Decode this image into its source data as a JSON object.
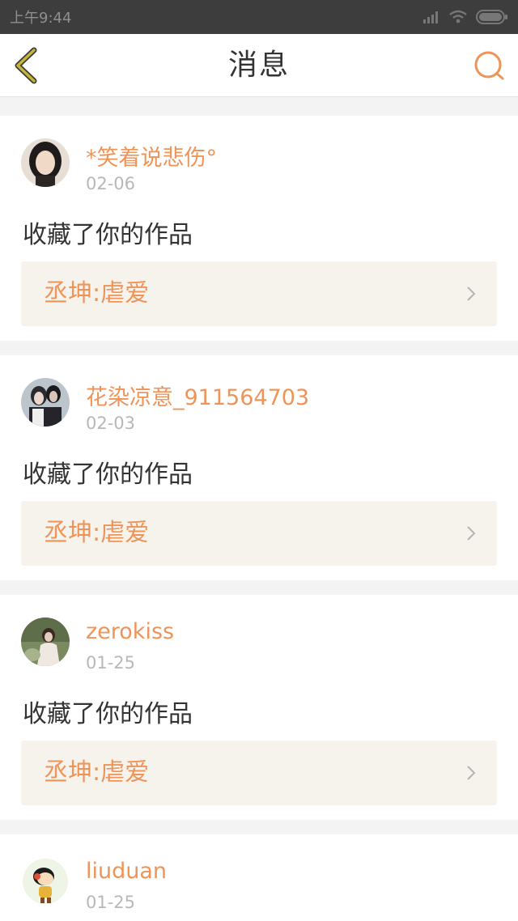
{
  "status_bar": {
    "time": "上午9:44",
    "icons": [
      "signal-icon",
      "wifi-icon",
      "battery-icon"
    ]
  },
  "header": {
    "title": "消息",
    "back_icon": "chevron-left-icon",
    "search_icon": "search-icon"
  },
  "colors": {
    "accent": "#ee9459",
    "back_arrow": "#b6ad2f",
    "card_link_bg": "#f5f3ec",
    "status_bar_bg": "#3d3d3d"
  },
  "messages": [
    {
      "username": "*笑着说悲伤°",
      "date": "02-06",
      "action": "收藏了你的作品",
      "work_title": "丞坤:虐爱"
    },
    {
      "username": "花染凉意_911564703",
      "date": "02-03",
      "action": "收藏了你的作品",
      "work_title": "丞坤:虐爱"
    },
    {
      "username": "zerokiss",
      "date": "01-25",
      "action": "收藏了你的作品",
      "work_title": "丞坤:虐爱"
    },
    {
      "username": "liuduan",
      "date": "01-25"
    }
  ]
}
